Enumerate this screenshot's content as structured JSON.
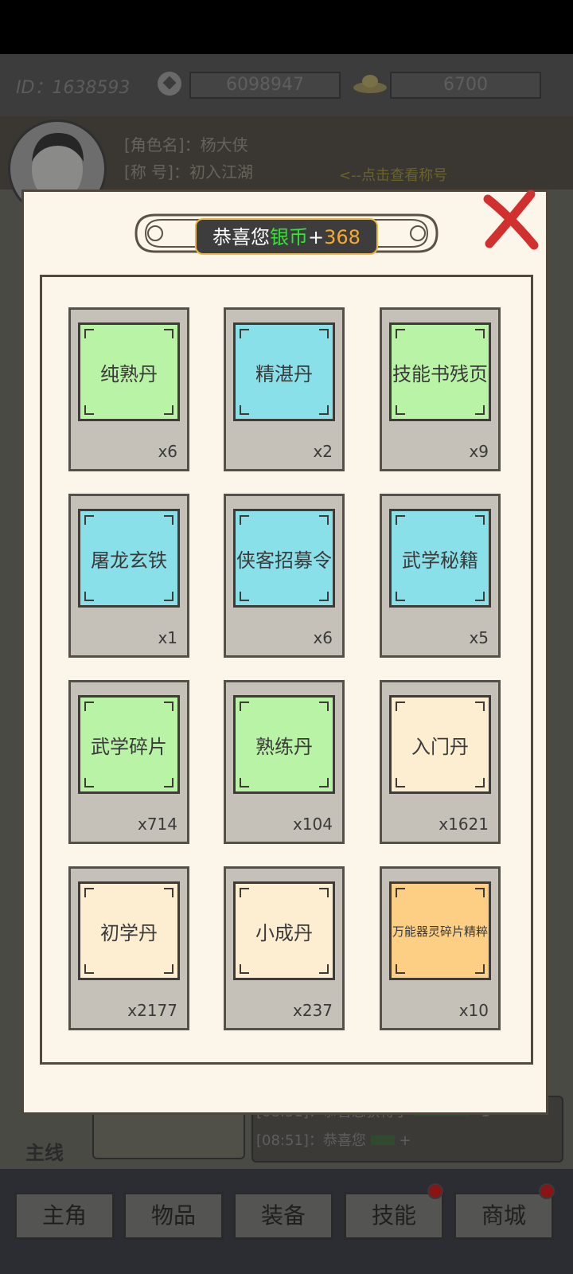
{
  "header": {
    "id_label": "ID：1638593",
    "silver_amount": "6098947",
    "gold_amount": "6700"
  },
  "character": {
    "name_line": "[角色名]：杨大侠",
    "title_line": "[称  号]：初入江湖",
    "title_hint": "<--点击查看称号"
  },
  "modal": {
    "toast_prefix": "恭喜您",
    "toast_currency": "银币",
    "toast_plus": "+",
    "toast_amount": "368",
    "items": [
      {
        "name": "纯熟丹",
        "count": "x6",
        "rarity": "green"
      },
      {
        "name": "精湛丹",
        "count": "x2",
        "rarity": "cyan"
      },
      {
        "name": "技能书残页",
        "count": "x9",
        "rarity": "green"
      },
      {
        "name": "屠龙玄铁",
        "count": "x1",
        "rarity": "cyan"
      },
      {
        "name": "侠客招募令",
        "count": "x6",
        "rarity": "cyan"
      },
      {
        "name": "武学秘籍",
        "count": "x5",
        "rarity": "cyan"
      },
      {
        "name": "武学碎片",
        "count": "x714",
        "rarity": "green"
      },
      {
        "name": "熟练丹",
        "count": "x104",
        "rarity": "green"
      },
      {
        "name": "入门丹",
        "count": "x1621",
        "rarity": "cream"
      },
      {
        "name": "初学丹",
        "count": "x2177",
        "rarity": "cream"
      },
      {
        "name": "小成丹",
        "count": "x237",
        "rarity": "cream"
      },
      {
        "name": "万能器灵碎片精粹",
        "count": "x10",
        "rarity": "orange"
      }
    ]
  },
  "chat": {
    "line1": "[08:51]：恭喜您获得了",
    "line1_suffix": "*1",
    "line2": "[08:51]：恭喜您",
    "line2_suffix": "+"
  },
  "main_quest_label": "主线",
  "nav": {
    "items": [
      {
        "label": "主角"
      },
      {
        "label": "物品"
      },
      {
        "label": "装备"
      },
      {
        "label": "技能"
      },
      {
        "label": "商城"
      }
    ]
  },
  "colors": {
    "green_card": "#b9f4a6",
    "cyan_card": "#8ae0e9",
    "cream_card": "#fdedd1",
    "orange_card": "#fdcf84",
    "toast_currency": "#34e334",
    "toast_amount": "#f7a928",
    "close_x": "#d2302f"
  }
}
